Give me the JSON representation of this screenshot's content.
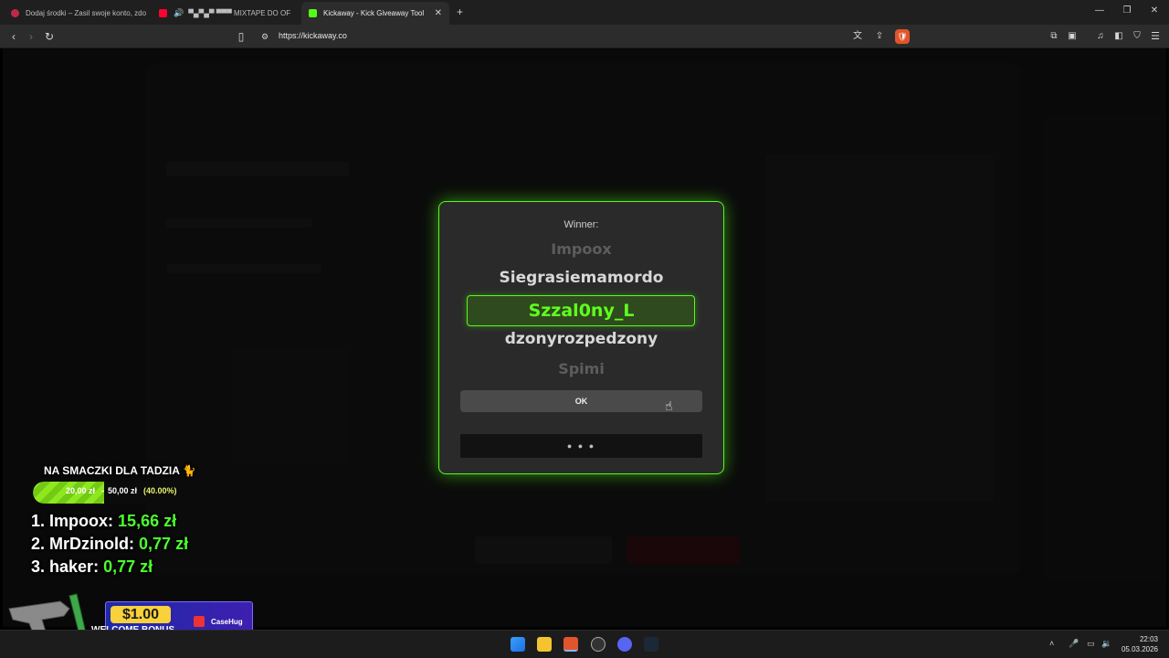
{
  "browser": {
    "tabs": [
      {
        "title": "Dodaj środki – Zasil swoje konto, zdo",
        "favicon_color": "#c0284a",
        "active": false
      },
      {
        "title": "▀▄▀▄▀ ▀▀▀ MIXTAPE DO OF",
        "favicon_color": "#ff0033",
        "active": false
      },
      {
        "title": "Kickaway - Kick Giveaway Tool",
        "favicon_color": "#53fc18",
        "active": true
      }
    ],
    "new_tab_symbol": "+",
    "url": "https://kickaway.co"
  },
  "modal": {
    "label": "Winner:",
    "names": [
      "Impoox",
      "Siegrasiemamordo",
      "Szzal0ny_L",
      "dzonyrozpedzony",
      "Spimi"
    ],
    "selected_index": 2,
    "ok_label": "OK",
    "loading_text": "● ● ●"
  },
  "stream_overlay": {
    "goal_title": "NA SMACZKI DLA TADZIA 🐈",
    "goal_current": "20,00 zł",
    "goal_separator": "-",
    "goal_max": "50,00 zł",
    "goal_percent_text": "(40.00%)",
    "goal_fraction": 0.4,
    "leaderboard": [
      {
        "rank": "1.",
        "name": "Impoox:",
        "amount": "15,66 zł"
      },
      {
        "rank": "2.",
        "name": "MrDzinold:",
        "amount": "0,77 zł"
      },
      {
        "rank": "3.",
        "name": "haker:",
        "amount": "0,77 zł"
      }
    ]
  },
  "ad": {
    "amount": "$1.00",
    "bonus_text": "WELCOME BONUS",
    "brand": "CaseHug"
  },
  "taskbar": {
    "time": "22:03",
    "date": "05.03.2026"
  }
}
